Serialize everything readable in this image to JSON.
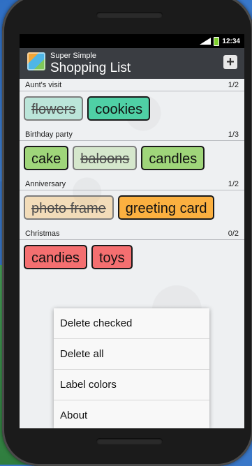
{
  "status": {
    "time": "12:34"
  },
  "app": {
    "subtitle": "Super Simple",
    "title": "Shopping List",
    "add_icon": "plus-icon"
  },
  "lists": [
    {
      "name": "Aunt's visit",
      "count": "1/2",
      "color": "#4fd0a5",
      "items": [
        {
          "label": "flowers",
          "checked": true
        },
        {
          "label": "cookies",
          "checked": false
        }
      ]
    },
    {
      "name": "Birthday party",
      "count": "1/3",
      "color": "#9fd57a",
      "items": [
        {
          "label": "cake",
          "checked": false
        },
        {
          "label": "baloons",
          "checked": true
        },
        {
          "label": "candles",
          "checked": false
        }
      ]
    },
    {
      "name": "Anniversary",
      "count": "1/2",
      "color": "#fbb040",
      "items": [
        {
          "label": "photo frame",
          "checked": true
        },
        {
          "label": "greeting card",
          "checked": false
        }
      ]
    },
    {
      "name": "Christmas",
      "count": "0/2",
      "color": "#f46f70",
      "items": [
        {
          "label": "candies",
          "checked": false
        },
        {
          "label": "toys",
          "checked": false
        }
      ]
    }
  ],
  "menu": {
    "items": [
      "Delete checked",
      "Delete all",
      "Label colors",
      "About"
    ]
  }
}
